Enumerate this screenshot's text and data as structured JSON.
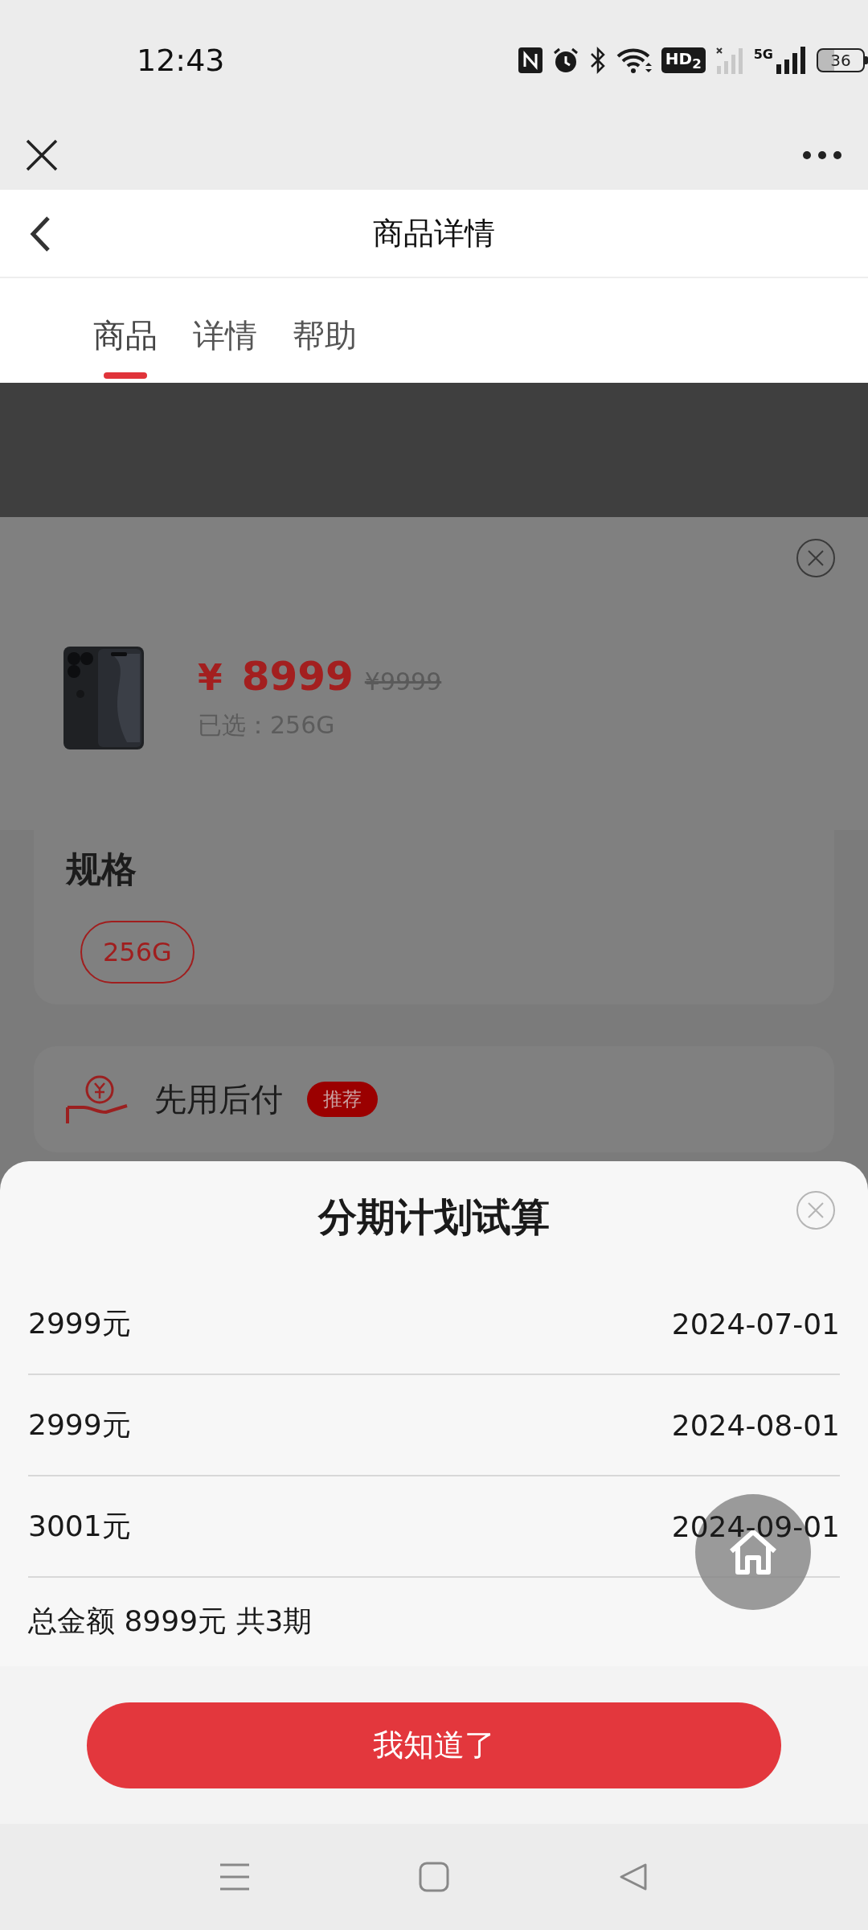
{
  "status_bar": {
    "time": "12:43",
    "hd_badge": "HD$_{2}$",
    "network": "5G",
    "battery": "36"
  },
  "title": "商品详情",
  "tabs": [
    {
      "label": "商品",
      "selected": true
    },
    {
      "label": "详情",
      "selected": false
    },
    {
      "label": "帮助",
      "selected": false
    }
  ],
  "product": {
    "price_symbol": "¥",
    "price": "8999",
    "original_price": "¥9999",
    "selected_label": "已选：256G",
    "spec_title": "规格",
    "spec_options": [
      {
        "label": "256G",
        "selected": true
      }
    ],
    "payment_option": {
      "label": "先用后付",
      "badge": "推荐"
    }
  },
  "plan": {
    "title": "分期计划试算",
    "installments": [
      {
        "amount": "2999元",
        "date": "2024-07-01"
      },
      {
        "amount": "2999元",
        "date": "2024-08-01"
      },
      {
        "amount": "3001元",
        "date": "2024-09-01"
      }
    ],
    "total": "总金额 8999元 共3期",
    "button": "我知道了"
  }
}
